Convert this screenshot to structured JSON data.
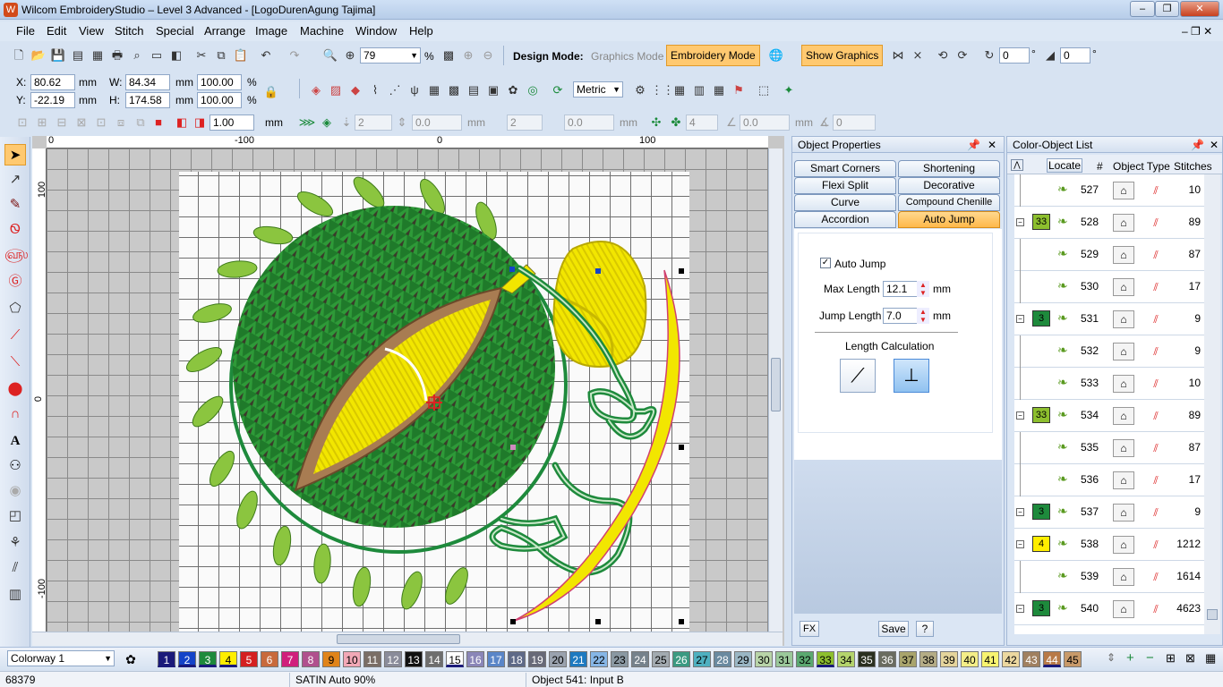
{
  "window": {
    "title": "Wilcom EmbroideryStudio – Level 3 Advanced - [LogoDurenAgung        Tajima]"
  },
  "menu": [
    "File",
    "Edit",
    "View",
    "Stitch",
    "Special",
    "Arrange",
    "Image",
    "Machine",
    "Window",
    "Help"
  ],
  "toolbar": {
    "zoom": "79",
    "zoom_unit": "%",
    "design_mode_label": "Design Mode:",
    "graphics_mode": "Graphics Mode",
    "embroidery_mode": "Embroidery Mode",
    "show_graphics": "Show Graphics",
    "rotate_value": "0",
    "slant_value": "0",
    "degree": "°"
  },
  "transform": {
    "x_label": "X:",
    "x": "80.62",
    "y_label": "Y:",
    "y": "-22.19",
    "w_label": "W:",
    "w": "84.34",
    "h_label": "H:",
    "h": "174.58",
    "unit": "mm",
    "scale_w": "100.00",
    "scale_h": "100.00",
    "pct": "%",
    "units_select": "Metric"
  },
  "toolbar3": {
    "outline_width": "1.00",
    "unit": "mm",
    "v1": "2",
    "v2": "0.0",
    "v3": "2",
    "v4": "0.0",
    "v5": "4",
    "v6": "0.0",
    "v7": "0",
    "unit_dim": "mm"
  },
  "ruler": {
    "top": [
      "0",
      "-100",
      "0",
      "100"
    ],
    "left": [
      "100",
      "0",
      "-100"
    ]
  },
  "object_properties": {
    "title": "Object Properties",
    "tabs": [
      "Smart Corners",
      "Shortening",
      "Flexi Split",
      "Decorative",
      "Curve",
      "Compound Chenille",
      "Accordion",
      "Auto Jump"
    ],
    "active_tab": "Auto Jump",
    "auto_jump_label": "Auto Jump",
    "auto_jump_checked": true,
    "max_length_label": "Max Length",
    "max_length": "12.1",
    "jump_length_label": "Jump Length",
    "jump_length": "7.0",
    "unit": "mm",
    "length_calc_label": "Length Calculation",
    "fx": "FX",
    "save": "Save",
    "help": "?"
  },
  "color_object_list": {
    "title": "Color-Object List",
    "locate": "Locate",
    "col_num": "#",
    "col_type": "Object Type",
    "col_stitches": "Stitches",
    "rows": [
      {
        "chip": "",
        "chip_color": "",
        "num": "527",
        "stitches": "10"
      },
      {
        "chip": "33",
        "chip_color": "#8dbf2e",
        "num": "528",
        "stitches": "89"
      },
      {
        "chip": "",
        "chip_color": "",
        "num": "529",
        "stitches": "87"
      },
      {
        "chip": "",
        "chip_color": "",
        "num": "530",
        "stitches": "17"
      },
      {
        "chip": "3",
        "chip_color": "#1e8a3c",
        "num": "531",
        "stitches": "9"
      },
      {
        "chip": "",
        "chip_color": "",
        "num": "532",
        "stitches": "9"
      },
      {
        "chip": "",
        "chip_color": "",
        "num": "533",
        "stitches": "10"
      },
      {
        "chip": "33",
        "chip_color": "#8dbf2e",
        "num": "534",
        "stitches": "89"
      },
      {
        "chip": "",
        "chip_color": "",
        "num": "535",
        "stitches": "87"
      },
      {
        "chip": "",
        "chip_color": "",
        "num": "536",
        "stitches": "17"
      },
      {
        "chip": "3",
        "chip_color": "#1e8a3c",
        "num": "537",
        "stitches": "9"
      },
      {
        "chip": "4",
        "chip_color": "#ffee00",
        "num": "538",
        "stitches": "1212"
      },
      {
        "chip": "",
        "chip_color": "",
        "num": "539",
        "stitches": "1614"
      },
      {
        "chip": "3",
        "chip_color": "#1e8a3c",
        "num": "540",
        "stitches": "4623"
      }
    ]
  },
  "palette": {
    "colorway": "Colorway 1",
    "swatches": [
      {
        "n": "1",
        "c": "#1a1a7a",
        "t": "#fff"
      },
      {
        "n": "2",
        "c": "#1443c8",
        "t": "#fff"
      },
      {
        "n": "3",
        "c": "#1e8a3c",
        "t": "#fff"
      },
      {
        "n": "4",
        "c": "#ffee00",
        "t": "#000"
      },
      {
        "n": "5",
        "c": "#d42020",
        "t": "#fff"
      },
      {
        "n": "6",
        "c": "#c86a3c",
        "t": "#fff"
      },
      {
        "n": "7",
        "c": "#d01f7c",
        "t": "#fff"
      },
      {
        "n": "8",
        "c": "#b0508e",
        "t": "#fff"
      },
      {
        "n": "9",
        "c": "#e0841a",
        "t": "#000"
      },
      {
        "n": "10",
        "c": "#f2a8b6",
        "t": "#000"
      },
      {
        "n": "11",
        "c": "#7a6e66",
        "t": "#fff"
      },
      {
        "n": "12",
        "c": "#8a8c9a",
        "t": "#fff"
      },
      {
        "n": "13",
        "c": "#111111",
        "t": "#fff"
      },
      {
        "n": "14",
        "c": "#6e6e6e",
        "t": "#fff"
      },
      {
        "n": "15",
        "c": "#ffffff",
        "t": "#000"
      },
      {
        "n": "16",
        "c": "#8a86b8",
        "t": "#fff"
      },
      {
        "n": "17",
        "c": "#5a86c8",
        "t": "#fff"
      },
      {
        "n": "18",
        "c": "#5e6a88",
        "t": "#fff"
      },
      {
        "n": "19",
        "c": "#686a78",
        "t": "#fff"
      },
      {
        "n": "20",
        "c": "#9aa2ae",
        "t": "#000"
      },
      {
        "n": "21",
        "c": "#1e7ac0",
        "t": "#fff"
      },
      {
        "n": "22",
        "c": "#86b6e6",
        "t": "#000"
      },
      {
        "n": "23",
        "c": "#8a98a2",
        "t": "#000"
      },
      {
        "n": "24",
        "c": "#76828c",
        "t": "#fff"
      },
      {
        "n": "25",
        "c": "#a2aab0",
        "t": "#000"
      },
      {
        "n": "26",
        "c": "#3a9a82",
        "t": "#fff"
      },
      {
        "n": "27",
        "c": "#4eb0c0",
        "t": "#000"
      },
      {
        "n": "28",
        "c": "#6a8aa0",
        "t": "#fff"
      },
      {
        "n": "29",
        "c": "#9ab6c4",
        "t": "#000"
      },
      {
        "n": "30",
        "c": "#b8d4a8",
        "t": "#000"
      },
      {
        "n": "31",
        "c": "#9ac89a",
        "t": "#000"
      },
      {
        "n": "32",
        "c": "#5aa870",
        "t": "#000"
      },
      {
        "n": "33",
        "c": "#8dbf2e",
        "t": "#000"
      },
      {
        "n": "34",
        "c": "#b4d46c",
        "t": "#000"
      },
      {
        "n": "35",
        "c": "#2a3020",
        "t": "#fff"
      },
      {
        "n": "36",
        "c": "#6a6c60",
        "t": "#fff"
      },
      {
        "n": "37",
        "c": "#a8a46c",
        "t": "#000"
      },
      {
        "n": "38",
        "c": "#b4ac86",
        "t": "#000"
      },
      {
        "n": "39",
        "c": "#e4d49c",
        "t": "#000"
      },
      {
        "n": "40",
        "c": "#f4ee88",
        "t": "#000"
      },
      {
        "n": "41",
        "c": "#f8f470",
        "t": "#000"
      },
      {
        "n": "42",
        "c": "#ecd8a0",
        "t": "#000"
      },
      {
        "n": "43",
        "c": "#a08060",
        "t": "#fff"
      },
      {
        "n": "44",
        "c": "#b87a48",
        "t": "#fff"
      },
      {
        "n": "45",
        "c": "#c89a6a",
        "t": "#000"
      }
    ]
  },
  "status": {
    "stitch_count": "68379",
    "stitch_type": "SATIN Auto 90%",
    "object": "Object 541: Input B"
  }
}
